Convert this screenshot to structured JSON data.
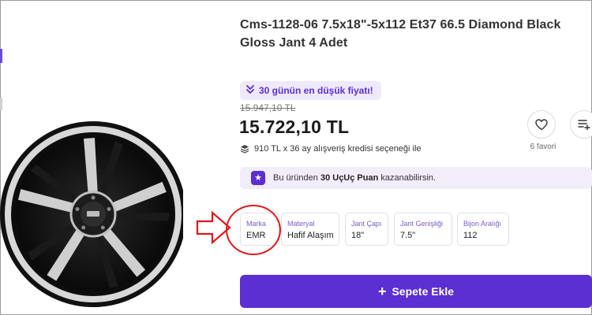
{
  "product": {
    "title": "Cms-1128-06 7.5x18\"-5x112 Et37 66.5 Diamond Black Gloss Jant 4 Adet",
    "lowest_price_badge": "30 günün en düşük fiyatı!",
    "old_price": "15.947,10 TL",
    "price": "15.722,10 TL",
    "credit_text": "910 TL x 36 ay alışveriş kredisi seçeneği ile",
    "favorites_count": "6 favori",
    "points": {
      "prefix": "Bu üründen",
      "bold": "30 UçUç Puan",
      "suffix": "kazanabilirsin."
    },
    "attributes": [
      {
        "key": "Marka",
        "value": "EMR"
      },
      {
        "key": "Materyal",
        "value": "Hafif Alaşım"
      },
      {
        "key": "Jant Çapı",
        "value": "18\""
      },
      {
        "key": "Jant Genişliği",
        "value": "7.5\""
      },
      {
        "key": "Bijon Aralığı",
        "value": "112"
      }
    ],
    "add_to_cart_label": "Sepete Ekle"
  },
  "icons": {
    "lowest_price": "chevron-double-down-icon",
    "credit": "stack-icon",
    "favorite": "heart-icon",
    "list": "add-to-list-icon",
    "points": "star-icon",
    "cart": "plus-icon"
  },
  "colors": {
    "accent": "#5b2fd1",
    "badge_bg": "#efe9fc",
    "annotation_red": "#e0161b"
  }
}
